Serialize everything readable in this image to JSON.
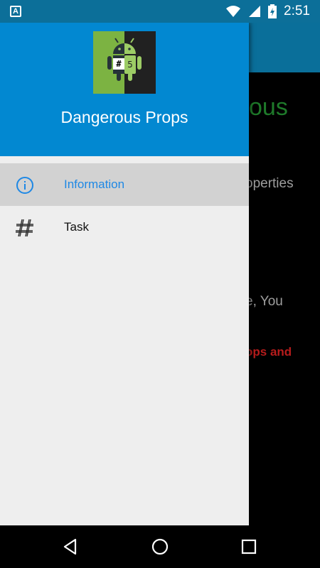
{
  "status_bar": {
    "time": "2:51",
    "notification_icon": "a-icon",
    "battery_icon": "battery-charging-icon"
  },
  "background": {
    "title_fragment": "ous",
    "line1_fragment": "operties",
    "line2_fragment": "e, You",
    "line3_fragment": "ops and"
  },
  "drawer": {
    "title": "Dangerous Props",
    "logo_badge": "#5",
    "items": [
      {
        "label": "Information",
        "icon": "info-icon",
        "active": true
      },
      {
        "label": "Task",
        "icon": "hash-icon",
        "active": false
      }
    ]
  },
  "colors": {
    "header": "#0288d1",
    "status_bar": "#0c6f99",
    "active_label": "#1e88e5",
    "logo_green": "#7cb342"
  }
}
